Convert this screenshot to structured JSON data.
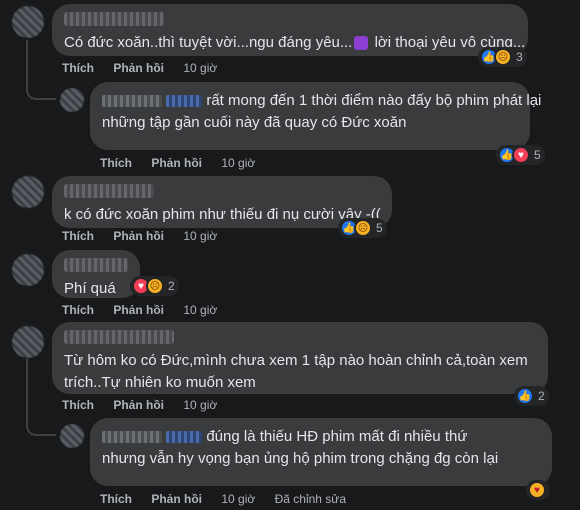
{
  "actions": {
    "like": "Thích",
    "reply": "Phản hồi",
    "edited": "Đã chỉnh sửa"
  },
  "comments": [
    {
      "text": "Có đức xoăn..thì tuyệt vời...ngu đáng yêu...",
      "text2": "lời thoại yêu vô cùng...",
      "time": "10 giờ",
      "reactions": [
        "like",
        "sad"
      ],
      "reaction_count": "3"
    },
    {
      "text": "rất mong đến 1 thời điểm nào đấy bộ phim phát lại",
      "text2": "những tập gần cuối này đã quay có Đức xoăn",
      "time": "10 giờ",
      "reactions": [
        "like",
        "love"
      ],
      "reaction_count": "5"
    },
    {
      "text": "k có đức xoăn phim như thiếu đi nụ cười vậy -((",
      "time": "10 giờ",
      "reactions": [
        "like",
        "sad"
      ],
      "reaction_count": "5"
    },
    {
      "text": "Phí quá",
      "time": "10 giờ",
      "reactions": [
        "love",
        "sad"
      ],
      "reaction_count": "2"
    },
    {
      "text": "Từ hôm ko có Đức,mình chưa xem 1 tập nào hoàn chỉnh cả,toàn xem",
      "text2": "trích..Tự nhiên ko muốn xem",
      "time": "10 giờ",
      "reactions": [
        "like"
      ],
      "reaction_count": "2"
    },
    {
      "text": "đúng là thiếu HĐ phim mất đi nhiều thứ",
      "text2": "nhưng vẫn hy vọng bạn ủng hộ phim trong chặng đg còn lại",
      "time": "10 giờ",
      "reactions": [
        "care"
      ],
      "reaction_count": ""
    }
  ],
  "colors": {
    "background": "#18191a",
    "bubble": "#3a3b3c",
    "text": "#e4e6eb",
    "meta": "#b0b3b8",
    "like": "#2078f4",
    "love": "#f33e58",
    "sad": "#f7b125"
  }
}
